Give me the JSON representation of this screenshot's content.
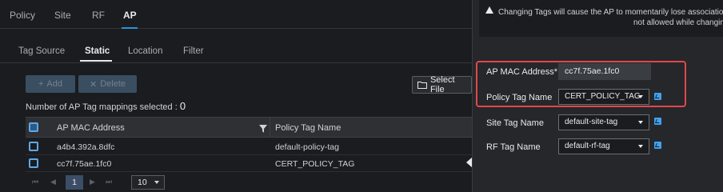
{
  "top_tabs": [
    "Policy",
    "Site",
    "RF",
    "AP"
  ],
  "sub_tabs": [
    "Tag Source",
    "Static",
    "Location",
    "Filter"
  ],
  "toolbar": {
    "add_label": "Add",
    "add_icon": "plus-icon",
    "delete_label": "Delete",
    "delete_icon": "x-icon",
    "select_file_label": "Select File",
    "select_file_icon": "folder-icon"
  },
  "selection": {
    "label": "Number of AP Tag mappings selected : ",
    "count": "0"
  },
  "table": {
    "columns": [
      "AP MAC Address",
      "Policy Tag Name"
    ],
    "rows": [
      {
        "mac": "a4b4.392a.8dfc",
        "policy_tag": "default-policy-tag"
      },
      {
        "mac": "cc7f.75ae.1fc0",
        "policy_tag": "CERT_POLICY_TAG"
      }
    ]
  },
  "pager": {
    "current_page": "1",
    "page_size": "10"
  },
  "warning": {
    "line1": "Changing Tags will cause the AP to momentarily lose association w",
    "line2": "not allowed while changing t"
  },
  "form": {
    "mac_label": "AP MAC Address*",
    "mac_value": "cc7f.75ae.1fc0",
    "policy_label": "Policy Tag Name",
    "policy_value": "CERT_POLICY_TAG",
    "site_label": "Site Tag Name",
    "site_value": "default-site-tag",
    "rf_label": "RF Tag Name",
    "rf_value": "default-rf-tag"
  },
  "colors": {
    "accent": "#2f8fd8",
    "highlight": "#e04848",
    "edit_icon": "#3fa2f0"
  }
}
